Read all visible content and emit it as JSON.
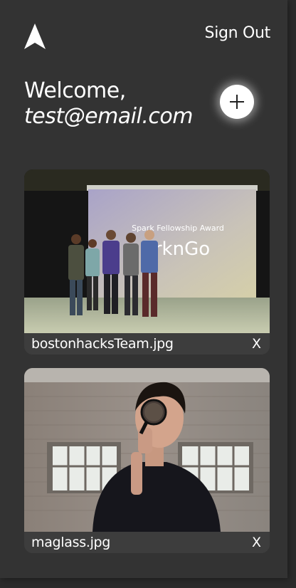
{
  "header": {
    "logo_icon": "navigation-arrow-icon",
    "signout_label": "Sign Out"
  },
  "welcome": {
    "greeting": "Welcome,",
    "email": "test@email.com"
  },
  "add_button": {
    "icon": "plus-icon"
  },
  "photos": [
    {
      "filename": "bostonhacksTeam.jpg",
      "screen_title": "Spark Fellowship Award",
      "screen_text": "rknGo",
      "close_label": "X"
    },
    {
      "filename": "maglass.jpg",
      "close_label": "X"
    }
  ],
  "colors": {
    "background": "#333333",
    "card": "#3d3d3d",
    "text": "#ffffff"
  }
}
